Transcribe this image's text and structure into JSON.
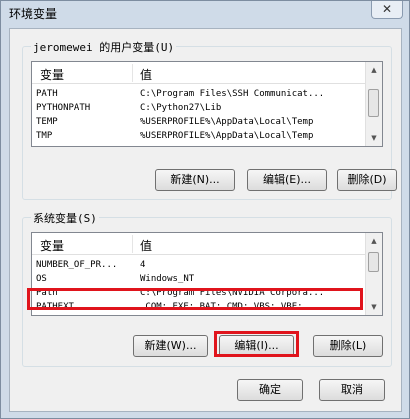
{
  "window": {
    "title": "环境变量",
    "close_glyph": "✕"
  },
  "user_vars": {
    "group_label": "jeromewei 的用户变量(U)",
    "columns": [
      "变量",
      "值"
    ],
    "rows": [
      {
        "name": "PATH",
        "value": "C:\\Program Files\\SSH Communicat..."
      },
      {
        "name": "PYTHONPATH",
        "value": "C:\\Python27\\Lib"
      },
      {
        "name": "TEMP",
        "value": "%USERPROFILE%\\AppData\\Local\\Temp"
      },
      {
        "name": "TMP",
        "value": "%USERPROFILE%\\AppData\\Local\\Temp"
      }
    ],
    "buttons": {
      "new": "新建(N)...",
      "edit": "编辑(E)...",
      "delete": "删除(D)"
    },
    "scroll_position": 0.4
  },
  "system_vars": {
    "group_label": "系统变量(S)",
    "columns": [
      "变量",
      "值"
    ],
    "rows": [
      {
        "name": "NUMBER_OF_PR...",
        "value": "4"
      },
      {
        "name": "OS",
        "value": "Windows_NT"
      },
      {
        "name": "Path",
        "value": "C:\\Program Files\\NVIDIA Corpora..."
      },
      {
        "name": "PATHEXT",
        "value": ".COM;.EXE;.BAT;.CMD;.VBS;.VBE;..."
      }
    ],
    "buttons": {
      "new": "新建(W)...",
      "edit": "编辑(I)...",
      "delete": "删除(L)"
    },
    "scroll_position": 0.3
  },
  "footer": {
    "ok": "确定",
    "cancel": "取消"
  },
  "colors": {
    "highlight": "#e0141c"
  }
}
